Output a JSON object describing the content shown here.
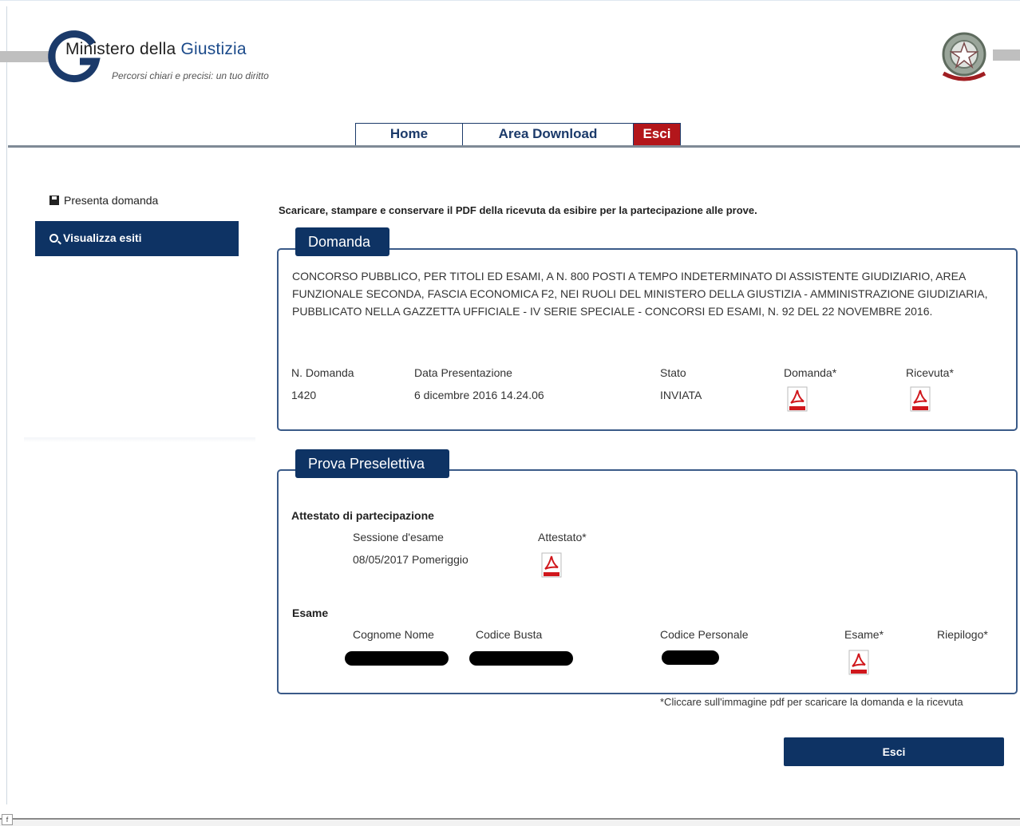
{
  "header": {
    "logo_title_prefix": "Ministero della ",
    "logo_title_accent": "Giustizia",
    "logo_subtitle": "Percorsi chiari e precisi: un tuo diritto",
    "nav": {
      "home": "Home",
      "download": "Area Download",
      "exit": "Esci"
    }
  },
  "sidebar": {
    "items": [
      {
        "label": "Presenta domanda",
        "icon": "save-icon"
      },
      {
        "label": "Visualizza esiti",
        "icon": "search-icon",
        "active": true
      }
    ]
  },
  "main": {
    "intro": "Scaricare, stampare e conservare il PDF della ricevuta da esibire per la partecipazione alle prove.",
    "domanda": {
      "tab": "Domanda",
      "description": "CONCORSO PUBBLICO, PER TITOLI ED ESAMI, A N. 800 POSTI A TEMPO INDETERMINATO DI ASSISTENTE GIUDIZIARIO, AREA FUNZIONALE SECONDA, FASCIA ECONOMICA F2, NEI RUOLI DEL MINISTERO DELLA GIUSTIZIA - AMMINISTRAZIONE GIUDIZIARIA, PUBBLICATO NELLA GAZZETTA UFFICIALE - IV SERIE SPECIALE - CONCORSI ED ESAMI, N. 92 DEL 22 NOVEMBRE 2016.",
      "headers": {
        "numero": "N. Domanda",
        "data": "Data Presentazione",
        "stato": "Stato",
        "domanda": "Domanda*",
        "ricevuta": "Ricevuta*"
      },
      "values": {
        "numero": "1420",
        "data": "6 dicembre 2016 14.24.06",
        "stato": "INVIATA"
      }
    },
    "preselettiva": {
      "tab": "Prova Preselettiva",
      "attestato_title": "Attestato di partecipazione",
      "sessione_header": "Sessione d'esame",
      "attestato_header": "Attestato*",
      "sessione_value": "08/05/2017 Pomeriggio",
      "esame_title": "Esame",
      "esame_headers": {
        "nome": "Cognome Nome",
        "busta": "Codice Busta",
        "personale": "Codice Personale",
        "esame": "Esame*",
        "riepilogo": "Riepilogo*"
      }
    },
    "note": "*Cliccare sull'immagine pdf per scaricare la domanda e la ricevuta",
    "exit_button": "Esci"
  },
  "colors": {
    "navy": "#0e3364",
    "panel_border": "#3a5a88",
    "exit_red": "#b3161b",
    "pdf_red": "#d0171c"
  }
}
